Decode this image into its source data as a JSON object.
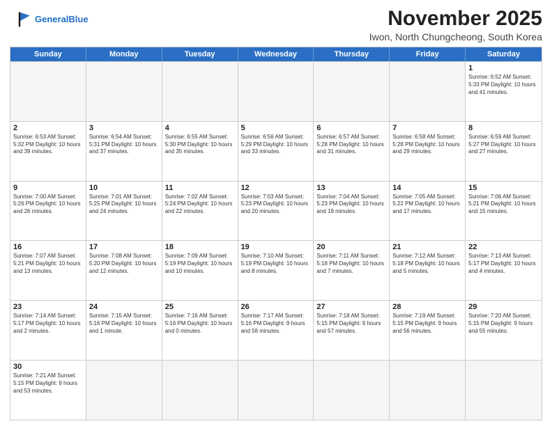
{
  "header": {
    "logo_general": "General",
    "logo_blue": "Blue",
    "month_title": "November 2025",
    "location": "Iwon, North Chungcheong, South Korea"
  },
  "days_of_week": [
    "Sunday",
    "Monday",
    "Tuesday",
    "Wednesday",
    "Thursday",
    "Friday",
    "Saturday"
  ],
  "weeks": [
    [
      {
        "day": "",
        "info": ""
      },
      {
        "day": "",
        "info": ""
      },
      {
        "day": "",
        "info": ""
      },
      {
        "day": "",
        "info": ""
      },
      {
        "day": "",
        "info": ""
      },
      {
        "day": "",
        "info": ""
      },
      {
        "day": "1",
        "info": "Sunrise: 6:52 AM\nSunset: 5:33 PM\nDaylight: 10 hours and 41 minutes."
      }
    ],
    [
      {
        "day": "2",
        "info": "Sunrise: 6:53 AM\nSunset: 5:32 PM\nDaylight: 10 hours and 39 minutes."
      },
      {
        "day": "3",
        "info": "Sunrise: 6:54 AM\nSunset: 5:31 PM\nDaylight: 10 hours and 37 minutes."
      },
      {
        "day": "4",
        "info": "Sunrise: 6:55 AM\nSunset: 5:30 PM\nDaylight: 10 hours and 35 minutes."
      },
      {
        "day": "5",
        "info": "Sunrise: 6:56 AM\nSunset: 5:29 PM\nDaylight: 10 hours and 33 minutes."
      },
      {
        "day": "6",
        "info": "Sunrise: 6:57 AM\nSunset: 5:28 PM\nDaylight: 10 hours and 31 minutes."
      },
      {
        "day": "7",
        "info": "Sunrise: 6:58 AM\nSunset: 5:28 PM\nDaylight: 10 hours and 29 minutes."
      },
      {
        "day": "8",
        "info": "Sunrise: 6:59 AM\nSunset: 5:27 PM\nDaylight: 10 hours and 27 minutes."
      }
    ],
    [
      {
        "day": "9",
        "info": "Sunrise: 7:00 AM\nSunset: 5:26 PM\nDaylight: 10 hours and 26 minutes."
      },
      {
        "day": "10",
        "info": "Sunrise: 7:01 AM\nSunset: 5:25 PM\nDaylight: 10 hours and 24 minutes."
      },
      {
        "day": "11",
        "info": "Sunrise: 7:02 AM\nSunset: 5:24 PM\nDaylight: 10 hours and 22 minutes."
      },
      {
        "day": "12",
        "info": "Sunrise: 7:03 AM\nSunset: 5:23 PM\nDaylight: 10 hours and 20 minutes."
      },
      {
        "day": "13",
        "info": "Sunrise: 7:04 AM\nSunset: 5:23 PM\nDaylight: 10 hours and 18 minutes."
      },
      {
        "day": "14",
        "info": "Sunrise: 7:05 AM\nSunset: 5:22 PM\nDaylight: 10 hours and 17 minutes."
      },
      {
        "day": "15",
        "info": "Sunrise: 7:06 AM\nSunset: 5:21 PM\nDaylight: 10 hours and 15 minutes."
      }
    ],
    [
      {
        "day": "16",
        "info": "Sunrise: 7:07 AM\nSunset: 5:21 PM\nDaylight: 10 hours and 13 minutes."
      },
      {
        "day": "17",
        "info": "Sunrise: 7:08 AM\nSunset: 5:20 PM\nDaylight: 10 hours and 12 minutes."
      },
      {
        "day": "18",
        "info": "Sunrise: 7:09 AM\nSunset: 5:19 PM\nDaylight: 10 hours and 10 minutes."
      },
      {
        "day": "19",
        "info": "Sunrise: 7:10 AM\nSunset: 5:19 PM\nDaylight: 10 hours and 8 minutes."
      },
      {
        "day": "20",
        "info": "Sunrise: 7:11 AM\nSunset: 5:18 PM\nDaylight: 10 hours and 7 minutes."
      },
      {
        "day": "21",
        "info": "Sunrise: 7:12 AM\nSunset: 5:18 PM\nDaylight: 10 hours and 5 minutes."
      },
      {
        "day": "22",
        "info": "Sunrise: 7:13 AM\nSunset: 5:17 PM\nDaylight: 10 hours and 4 minutes."
      }
    ],
    [
      {
        "day": "23",
        "info": "Sunrise: 7:14 AM\nSunset: 5:17 PM\nDaylight: 10 hours and 2 minutes."
      },
      {
        "day": "24",
        "info": "Sunrise: 7:15 AM\nSunset: 5:16 PM\nDaylight: 10 hours and 1 minute."
      },
      {
        "day": "25",
        "info": "Sunrise: 7:16 AM\nSunset: 5:16 PM\nDaylight: 10 hours and 0 minutes."
      },
      {
        "day": "26",
        "info": "Sunrise: 7:17 AM\nSunset: 5:16 PM\nDaylight: 9 hours and 58 minutes."
      },
      {
        "day": "27",
        "info": "Sunrise: 7:18 AM\nSunset: 5:15 PM\nDaylight: 9 hours and 57 minutes."
      },
      {
        "day": "28",
        "info": "Sunrise: 7:19 AM\nSunset: 5:15 PM\nDaylight: 9 hours and 56 minutes."
      },
      {
        "day": "29",
        "info": "Sunrise: 7:20 AM\nSunset: 5:15 PM\nDaylight: 9 hours and 55 minutes."
      }
    ],
    [
      {
        "day": "30",
        "info": "Sunrise: 7:21 AM\nSunset: 5:15 PM\nDaylight: 9 hours and 53 minutes."
      },
      {
        "day": "",
        "info": ""
      },
      {
        "day": "",
        "info": ""
      },
      {
        "day": "",
        "info": ""
      },
      {
        "day": "",
        "info": ""
      },
      {
        "day": "",
        "info": ""
      },
      {
        "day": "",
        "info": ""
      }
    ]
  ]
}
